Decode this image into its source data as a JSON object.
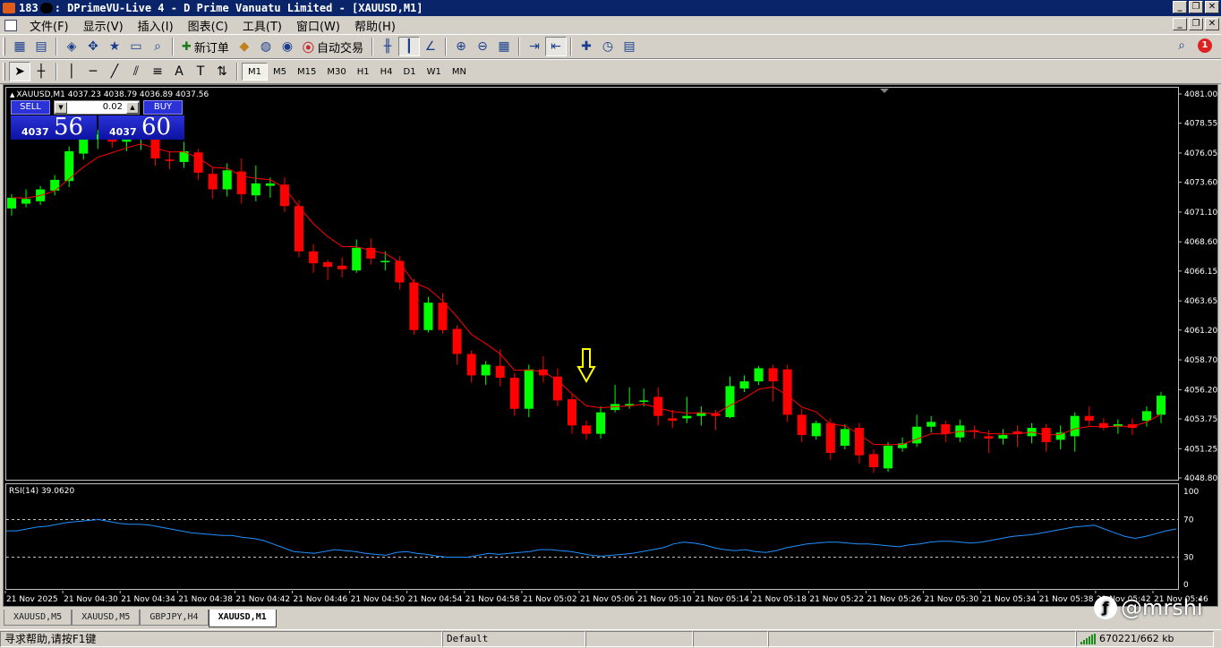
{
  "window": {
    "title_prefix": "183",
    "title": ": DPrimeVU-Live 4 - D Prime Vanuatu Limited - [XAUUSD,M1]",
    "buttons": [
      "_",
      "❐",
      "✕"
    ]
  },
  "menu": [
    "文件(F)",
    "显示(V)",
    "插入(I)",
    "图表(C)",
    "工具(T)",
    "窗口(W)",
    "帮助(H)"
  ],
  "toolbar": {
    "new_order": "新订单",
    "autotrading": "自动交易",
    "notification_count": "1"
  },
  "timeframes": [
    "M1",
    "M5",
    "M15",
    "M30",
    "H1",
    "H4",
    "D1",
    "W1",
    "MN"
  ],
  "active_timeframe": "M1",
  "chart": {
    "info": "XAUUSD,M1  4037.23 4038.79 4036.89 4037.56",
    "sell_label": "SELL",
    "buy_label": "BUY",
    "lot": "0.02",
    "sell_small": "4037",
    "sell_big": "56",
    "buy_small": "4037",
    "buy_big": "60",
    "rsi_label": "RSI(14) 39.0620"
  },
  "chart_data": {
    "type": "candlestick",
    "symbol": "XAUUSD",
    "timeframe": "M1",
    "ylim": [
      4048.8,
      4081.0
    ],
    "y_ticks": [
      "4081.00",
      "4078.55",
      "4076.05",
      "4073.60",
      "4071.10",
      "4068.60",
      "4066.15",
      "4063.65",
      "4061.20",
      "4058.70",
      "4056.20",
      "4053.75",
      "4051.25",
      "4048.80"
    ],
    "x_ticks": [
      "21 Nov 2025",
      "21 Nov 04:30",
      "21 Nov 04:34",
      "21 Nov 04:38",
      "21 Nov 04:42",
      "21 Nov 04:46",
      "21 Nov 04:50",
      "21 Nov 04:54",
      "21 Nov 04:58",
      "21 Nov 05:02",
      "21 Nov 05:06",
      "21 Nov 05:10",
      "21 Nov 05:14",
      "21 Nov 05:18",
      "21 Nov 05:22",
      "21 Nov 05:26",
      "21 Nov 05:30",
      "21 Nov 05:34",
      "21 Nov 05:38",
      "21 Nov 05:42",
      "21 Nov 05:46"
    ],
    "candles": [
      [
        4071.4,
        4072.3,
        4070.8,
        4072.6
      ],
      [
        4071.8,
        4072.2,
        4071.5,
        4073.0
      ],
      [
        4072.0,
        4073.0,
        4071.7,
        4073.3
      ],
      [
        4072.9,
        4073.8,
        4072.5,
        4074.2
      ],
      [
        4073.7,
        4076.2,
        4073.2,
        4076.6
      ],
      [
        4076.0,
        4077.2,
        4075.5,
        4077.8
      ],
      [
        4077.2,
        4077.6,
        4076.4,
        4078.0
      ],
      [
        4077.3,
        4077.0,
        4076.5,
        4077.8
      ],
      [
        4077.0,
        4077.4,
        4076.2,
        4078.0
      ],
      [
        4077.3,
        4077.6,
        4076.3,
        4078.2
      ],
      [
        4077.5,
        4075.6,
        4075.0,
        4078.4
      ],
      [
        4075.5,
        4075.4,
        4074.7,
        4076.2
      ],
      [
        4075.3,
        4076.2,
        4074.8,
        4077.0
      ],
      [
        4076.1,
        4074.4,
        4073.8,
        4076.4
      ],
      [
        4074.3,
        4073.0,
        4072.2,
        4074.8
      ],
      [
        4073.0,
        4074.6,
        4072.4,
        4075.2
      ],
      [
        4074.5,
        4072.6,
        4071.8,
        4075.6
      ],
      [
        4072.5,
        4073.5,
        4072.0,
        4075.0
      ],
      [
        4073.3,
        4073.5,
        4072.3,
        4074.0
      ],
      [
        4073.4,
        4071.6,
        4071.1,
        4074.0
      ],
      [
        4071.6,
        4067.8,
        4067.3,
        4072.1
      ],
      [
        4067.8,
        4066.8,
        4066.0,
        4068.4
      ],
      [
        4066.9,
        4066.5,
        4065.4,
        4067.1
      ],
      [
        4066.6,
        4066.3,
        4065.6,
        4067.3
      ],
      [
        4066.2,
        4068.1,
        4066.0,
        4068.8
      ],
      [
        4068.1,
        4067.2,
        4066.7,
        4068.9
      ],
      [
        4067.0,
        4067.0,
        4066.2,
        4067.8
      ],
      [
        4067.0,
        4065.2,
        4064.6,
        4067.4
      ],
      [
        4065.2,
        4061.2,
        4060.8,
        4065.5
      ],
      [
        4061.2,
        4063.5,
        4061.0,
        4064.0
      ],
      [
        4063.5,
        4061.2,
        4060.9,
        4064.3
      ],
      [
        4061.3,
        4059.2,
        4058.3,
        4061.6
      ],
      [
        4059.2,
        4057.4,
        4056.8,
        4059.5
      ],
      [
        4057.4,
        4058.3,
        4056.6,
        4058.6
      ],
      [
        4058.2,
        4057.2,
        4056.5,
        4059.6
      ],
      [
        4057.2,
        4054.6,
        4054.0,
        4057.6
      ],
      [
        4054.6,
        4057.9,
        4053.9,
        4058.3
      ],
      [
        4057.9,
        4057.4,
        4056.8,
        4059.0
      ],
      [
        4057.3,
        4055.3,
        4054.8,
        4058.0
      ],
      [
        4055.4,
        4053.2,
        4052.5,
        4055.8
      ],
      [
        4053.2,
        4052.5,
        4052.0,
        4053.6
      ],
      [
        4052.5,
        4054.3,
        4052.1,
        4054.8
      ],
      [
        4054.5,
        4055.0,
        4054.3,
        4056.6
      ],
      [
        4055.0,
        4055.0,
        4054.6,
        4056.4
      ],
      [
        4055.2,
        4055.3,
        4054.8,
        4056.3
      ],
      [
        4055.6,
        4054.0,
        4053.2,
        4056.4
      ],
      [
        4053.8,
        4053.6,
        4053.0,
        4054.5
      ],
      [
        4053.8,
        4054.0,
        4053.4,
        4055.6
      ],
      [
        4054.0,
        4054.3,
        4053.2,
        4054.8
      ],
      [
        4054.2,
        4054.0,
        4052.8,
        4054.5
      ],
      [
        4053.9,
        4056.5,
        4053.8,
        4057.3
      ],
      [
        4056.3,
        4056.9,
        4056.0,
        4057.4
      ],
      [
        4056.9,
        4058.0,
        4056.6,
        4058.2
      ],
      [
        4058.0,
        4056.9,
        4055.2,
        4058.3
      ],
      [
        4057.9,
        4054.1,
        4053.5,
        4058.3
      ],
      [
        4054.1,
        4052.4,
        4051.8,
        4054.6
      ],
      [
        4052.3,
        4053.4,
        4052.0,
        4053.6
      ],
      [
        4053.4,
        4050.9,
        4050.3,
        4053.8
      ],
      [
        4051.5,
        4052.9,
        4051.2,
        4053.3
      ],
      [
        4053.0,
        4050.7,
        4050.0,
        4053.4
      ],
      [
        4050.8,
        4049.7,
        4049.2,
        4051.2
      ],
      [
        4049.6,
        4051.5,
        4049.3,
        4051.8
      ],
      [
        4051.3,
        4051.7,
        4051.0,
        4052.2
      ],
      [
        4051.7,
        4053.1,
        4051.4,
        4054.1
      ],
      [
        4053.1,
        4053.5,
        4052.6,
        4054.0
      ],
      [
        4053.3,
        4052.5,
        4051.8,
        4053.6
      ],
      [
        4052.2,
        4053.2,
        4051.8,
        4053.7
      ],
      [
        4052.8,
        4052.7,
        4052.1,
        4053.2
      ],
      [
        4052.3,
        4052.1,
        4050.9,
        4052.8
      ],
      [
        4052.1,
        4052.4,
        4051.6,
        4052.9
      ],
      [
        4052.7,
        4052.5,
        4051.4,
        4053.2
      ],
      [
        4052.3,
        4053.0,
        4051.7,
        4053.4
      ],
      [
        4053.0,
        4051.8,
        4051.0,
        4053.3
      ],
      [
        4052.0,
        4052.6,
        4051.2,
        4053.2
      ],
      [
        4052.3,
        4054.0,
        4051.0,
        4054.3
      ],
      [
        4054.0,
        4053.6,
        4053.2,
        4054.8
      ],
      [
        4053.4,
        4053.0,
        4052.8,
        4053.8
      ],
      [
        4053.1,
        4053.3,
        4052.5,
        4053.7
      ],
      [
        4053.3,
        4053.0,
        4052.4,
        4053.8
      ],
      [
        4053.6,
        4054.4,
        4053.1,
        4054.8
      ],
      [
        4054.1,
        4055.7,
        4053.4,
        4056.0
      ],
      [
        4055.6,
        4055.8,
        4055.4,
        4056.4
      ],
      [
        4055.8,
        4056.6,
        4055.4,
        4057.2
      ],
      [
        4056.5,
        4057.3,
        4056.2,
        4057.6
      ],
      [
        4057.0,
        4056.4,
        4055.5,
        4057.4
      ],
      [
        4057.3,
        4054.3,
        4053.9,
        4057.6
      ],
      [
        4054.2,
        4052.7,
        4052.0,
        4054.6
      ],
      [
        4053.2,
        4053.8,
        4052.3,
        4054.0
      ],
      [
        4054.1,
        4056.9,
        4053.6,
        4057.3
      ]
    ],
    "ma_series": "MA overlay (red)",
    "rsi": {
      "label": "RSI(14) 39.0620",
      "ylim": [
        0,
        100
      ],
      "levels": [
        70,
        30
      ],
      "tick_labels": [
        "100",
        "70",
        "30",
        "0"
      ],
      "values": [
        58,
        58,
        60,
        62,
        63,
        65,
        67,
        68,
        69,
        70,
        68,
        66,
        65,
        65,
        64,
        62,
        60,
        58,
        56,
        55,
        54,
        53,
        53,
        51,
        50,
        48,
        44,
        40,
        36,
        35,
        34,
        36,
        38,
        37,
        36,
        34,
        33,
        32,
        35,
        36,
        34,
        33,
        31,
        30,
        30,
        30,
        32,
        34,
        33,
        34,
        35,
        36,
        38,
        38,
        37,
        36,
        34,
        32,
        31,
        32,
        33,
        34,
        36,
        38,
        40,
        44,
        46,
        45,
        43,
        40,
        38,
        37,
        38,
        36,
        35,
        37,
        40,
        42,
        44,
        45,
        46,
        46,
        45,
        44,
        44,
        43,
        42,
        41,
        43,
        44,
        46,
        47,
        47,
        46,
        45,
        46,
        48,
        50,
        52,
        53,
        54,
        56,
        58,
        60,
        62,
        63,
        64,
        60,
        56,
        52,
        50,
        52,
        55,
        58,
        60
      ]
    }
  },
  "tabs": [
    "XAUUSD,M5",
    "XAUUSD,M5",
    "GBPJPY,H4",
    "XAUUSD,M1"
  ],
  "active_tab": "XAUUSD,M1",
  "status": {
    "help": "寻求帮助,请按F1键",
    "profile": "Default",
    "traffic": "670221/662 kb"
  },
  "watermark": "@mrshi",
  "colors": {
    "bull": "#00ff00",
    "bear": "#ff0000",
    "ma": "#ff0000",
    "rsi_line": "#1e90ff",
    "arrow": "#ffff00",
    "titlebar": "#0a246a"
  }
}
